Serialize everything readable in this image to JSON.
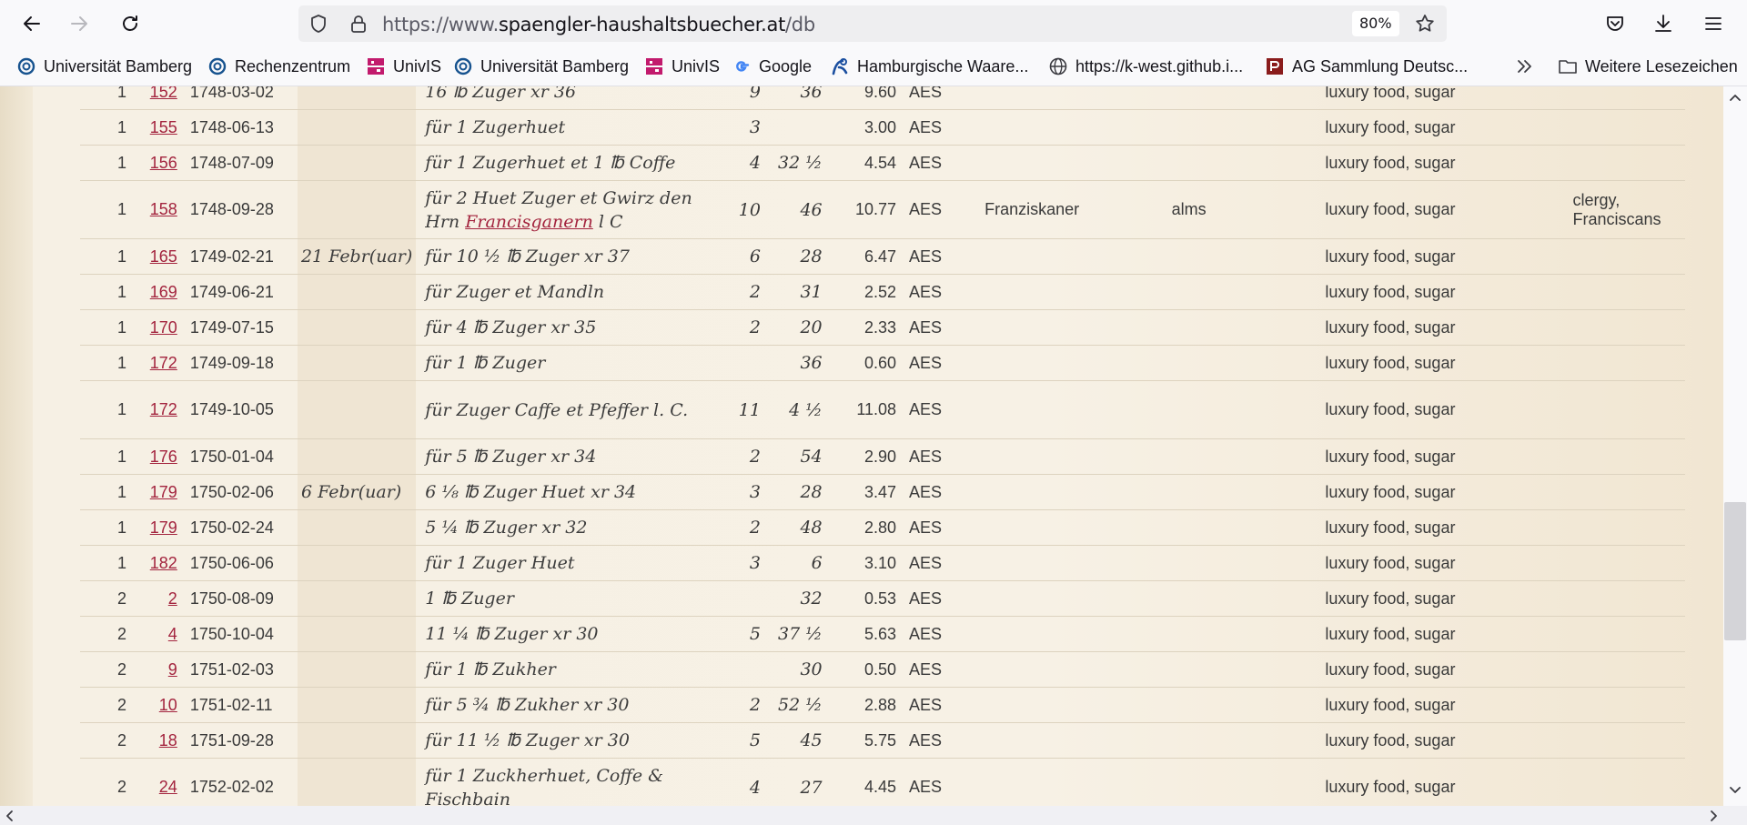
{
  "browser": {
    "url_prefix": "https://www.",
    "url_domain": "spaengler-haushaltsbuecher.at",
    "url_path": "/db",
    "zoom": "80%"
  },
  "bookmarks": [
    {
      "label": "Universität Bamberg",
      "icon": "bamberg-logo-icon"
    },
    {
      "label": "Rechenzentrum",
      "icon": "bamberg-logo-icon"
    },
    {
      "label": "UnivIS",
      "icon": "univis-logo-icon"
    },
    {
      "label": "Universität Bamberg",
      "icon": "bamberg-logo-icon"
    },
    {
      "label": "UnivIS",
      "icon": "univis-logo-icon"
    },
    {
      "label": "Google",
      "icon": "google-logo-icon"
    },
    {
      "label": "Hamburgische Waare...",
      "icon": "hamburg-logo-icon"
    },
    {
      "label": "https://k-west.github.i...",
      "icon": "globe-icon"
    },
    {
      "label": "AG Sammlung Deutsc...",
      "icon": "ag-logo-icon"
    },
    {
      "label": "Weitere Lesezeichen",
      "icon": "folder-icon"
    }
  ],
  "rows": [
    {
      "vol": "1",
      "folio": "152",
      "date": "1748-03-02",
      "orig": "",
      "desc": "16 ℔ Zuger xr 36",
      "desc_link": "",
      "fl": "9",
      "kr": "36",
      "val": "9.60",
      "cur": "AES",
      "rec": "",
      "ty": "",
      "cat": "luxury food, sugar",
      "rt": ""
    },
    {
      "vol": "1",
      "folio": "155",
      "date": "1748-06-13",
      "orig": "",
      "desc": "für 1 Zugerhuet",
      "desc_link": "",
      "fl": "3",
      "kr": "",
      "val": "3.00",
      "cur": "AES",
      "rec": "",
      "ty": "",
      "cat": "luxury food, sugar",
      "rt": ""
    },
    {
      "vol": "1",
      "folio": "156",
      "date": "1748-07-09",
      "orig": "",
      "desc": "für 1 Zugerhuet et 1 ℔ Coffe",
      "desc_link": "",
      "fl": "4",
      "kr": "32 ½",
      "val": "4.54",
      "cur": "AES",
      "rec": "",
      "ty": "",
      "cat": "luxury food, sugar",
      "rt": ""
    },
    {
      "vol": "1",
      "folio": "158",
      "date": "1748-09-28",
      "orig": "",
      "desc": "für 2 Huet Zuger et Gwirz den Hrn ",
      "desc_link": "Francisganern",
      "desc_after": " l C",
      "fl": "10",
      "kr": "46",
      "val": "10.77",
      "cur": "AES",
      "rec": "Franziskaner",
      "ty": "alms",
      "cat": "luxury food, sugar",
      "rt": "clergy, Franciscans"
    },
    {
      "vol": "1",
      "folio": "165",
      "date": "1749-02-21",
      "orig": "21  Febr(uar)",
      "desc": "für 10 ½ ℔ Zuger xr 37",
      "desc_link": "",
      "fl": "6",
      "kr": "28",
      "val": "6.47",
      "cur": "AES",
      "rec": "",
      "ty": "",
      "cat": "luxury food, sugar",
      "rt": ""
    },
    {
      "vol": "1",
      "folio": "169",
      "date": "1749-06-21",
      "orig": "",
      "desc": "für Zuger et Mandln",
      "desc_link": "",
      "fl": "2",
      "kr": "31",
      "val": "2.52",
      "cur": "AES",
      "rec": "",
      "ty": "",
      "cat": "luxury food, sugar",
      "rt": ""
    },
    {
      "vol": "1",
      "folio": "170",
      "date": "1749-07-15",
      "orig": "",
      "desc": "für 4 ℔ Zuger xr 35",
      "desc_link": "",
      "fl": "2",
      "kr": "20",
      "val": "2.33",
      "cur": "AES",
      "rec": "",
      "ty": "",
      "cat": "luxury food, sugar",
      "rt": ""
    },
    {
      "vol": "1",
      "folio": "172",
      "date": "1749-09-18",
      "orig": "",
      "desc": "für 1 ℔ Zuger",
      "desc_link": "",
      "fl": "",
      "kr": "36",
      "val": "0.60",
      "cur": "AES",
      "rec": "",
      "ty": "",
      "cat": "luxury food, sugar",
      "rt": ""
    },
    {
      "vol": "1",
      "folio": "172",
      "date": "1749-10-05",
      "orig": "",
      "desc": "für Zuger Caffe et Pfeffer l. C.",
      "desc_link": "",
      "fl": "11",
      "kr": "4 ½",
      "val": "11.08",
      "cur": "AES",
      "rec": "",
      "ty": "",
      "cat": "luxury food, sugar",
      "rt": ""
    },
    {
      "vol": "1",
      "folio": "176",
      "date": "1750-01-04",
      "orig": "",
      "desc": "für 5 ℔ Zuger xr 34",
      "desc_link": "",
      "fl": "2",
      "kr": "54",
      "val": "2.90",
      "cur": "AES",
      "rec": "",
      "ty": "",
      "cat": "luxury food, sugar",
      "rt": ""
    },
    {
      "vol": "1",
      "folio": "179",
      "date": "1750-02-06",
      "orig": "6  Febr(uar)",
      "desc": "6 ⅛ ℔ Zuger Huet xr 34",
      "desc_link": "",
      "fl": "3",
      "kr": "28",
      "val": "3.47",
      "cur": "AES",
      "rec": "",
      "ty": "",
      "cat": "luxury food, sugar",
      "rt": ""
    },
    {
      "vol": "1",
      "folio": "179",
      "date": "1750-02-24",
      "orig": "",
      "desc": "5 ¼ ℔ Zuger xr 32",
      "desc_link": "",
      "fl": "2",
      "kr": "48",
      "val": "2.80",
      "cur": "AES",
      "rec": "",
      "ty": "",
      "cat": "luxury food, sugar",
      "rt": ""
    },
    {
      "vol": "1",
      "folio": "182",
      "date": "1750-06-06",
      "orig": "",
      "desc": "für 1 Zuger Huet",
      "desc_link": "",
      "fl": "3",
      "kr": "6",
      "val": "3.10",
      "cur": "AES",
      "rec": "",
      "ty": "",
      "cat": "luxury food, sugar",
      "rt": ""
    },
    {
      "vol": "2",
      "folio": "2",
      "date": "1750-08-09",
      "orig": "",
      "desc": "1 ℔ Zuger",
      "desc_link": "",
      "fl": "",
      "kr": "32",
      "val": "0.53",
      "cur": "AES",
      "rec": "",
      "ty": "",
      "cat": "luxury food, sugar",
      "rt": ""
    },
    {
      "vol": "2",
      "folio": "4",
      "date": "1750-10-04",
      "orig": "",
      "desc": "11 ¼ ℔ Zuger xr 30",
      "desc_link": "",
      "fl": "5",
      "kr": "37 ½",
      "val": "5.63",
      "cur": "AES",
      "rec": "",
      "ty": "",
      "cat": "luxury food, sugar",
      "rt": ""
    },
    {
      "vol": "2",
      "folio": "9",
      "date": "1751-02-03",
      "orig": "",
      "desc": "für 1 ℔ Zukher",
      "desc_link": "",
      "fl": "",
      "kr": "30",
      "val": "0.50",
      "cur": "AES",
      "rec": "",
      "ty": "",
      "cat": "luxury food, sugar",
      "rt": ""
    },
    {
      "vol": "2",
      "folio": "10",
      "date": "1751-02-11",
      "orig": "",
      "desc": "für 5 ¾ ℔ Zukher xr 30",
      "desc_link": "",
      "fl": "2",
      "kr": "52 ½",
      "val": "2.88",
      "cur": "AES",
      "rec": "",
      "ty": "",
      "cat": "luxury food, sugar",
      "rt": ""
    },
    {
      "vol": "2",
      "folio": "18",
      "date": "1751-09-28",
      "orig": "",
      "desc": "für 11 ½ ℔ Zuger xr 30",
      "desc_link": "",
      "fl": "5",
      "kr": "45",
      "val": "5.75",
      "cur": "AES",
      "rec": "",
      "ty": "",
      "cat": "luxury food, sugar",
      "rt": ""
    },
    {
      "vol": "2",
      "folio": "24",
      "date": "1752-02-02",
      "orig": "",
      "desc": "für 1 Zuckherhuet, Coffe & Fischbain",
      "desc_link": "",
      "fl": "4",
      "kr": "27",
      "val": "4.45",
      "cur": "AES",
      "rec": "",
      "ty": "",
      "cat": "luxury food, sugar",
      "rt": ""
    }
  ]
}
